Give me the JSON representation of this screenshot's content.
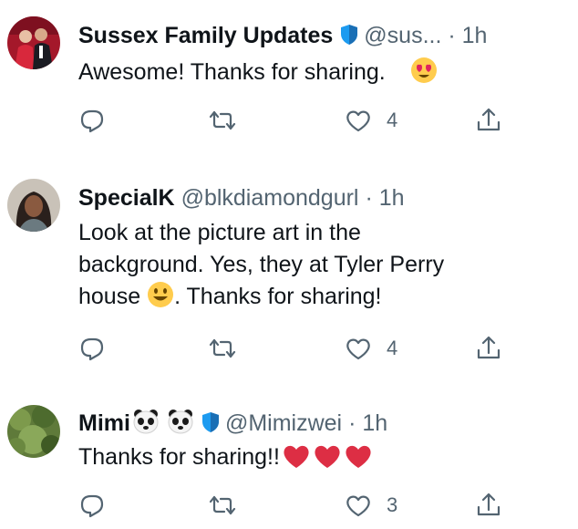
{
  "tweets": [
    {
      "name": "Sussex Family Updates",
      "handle": "@sus...",
      "dot": "·",
      "time": "1h",
      "text": "Awesome!  Thanks for sharing.",
      "likes": "4",
      "verified": true
    },
    {
      "name": "SpecialK",
      "handle": "@blkdiamondgurl",
      "dot": "·",
      "time": "1h",
      "text_line1": "Look at the picture art  in the",
      "text_line2": "background. Yes, they at Tyler Perry",
      "text_line3a": "house",
      "text_line3b": ".  Thanks for sharing!",
      "likes": "4"
    },
    {
      "name": "Mimi",
      "handle": "@Mimizwei",
      "dot": "·",
      "time": "1h",
      "text": "Thanks for sharing!!",
      "likes": "3",
      "verified": true
    }
  ],
  "icons": {
    "reply": "reply-icon",
    "retweet": "retweet-icon",
    "like": "heart-outline-icon",
    "share": "share-icon"
  },
  "colors": {
    "verified": "#1d9bf0",
    "muted": "#536471",
    "heart": "#e0245e"
  }
}
